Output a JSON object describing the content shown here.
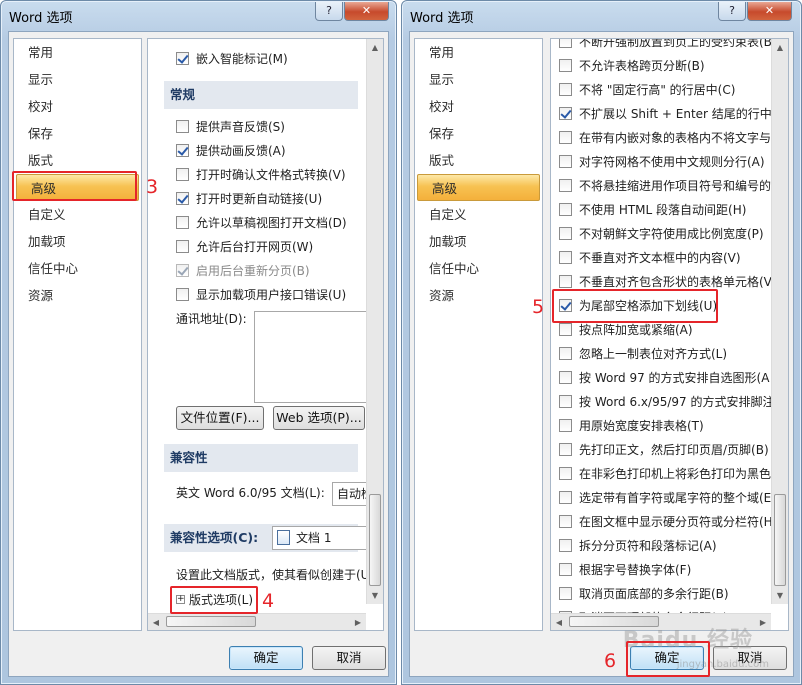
{
  "left": {
    "title": "Word 选项",
    "help": "?",
    "close": "✕",
    "nav": [
      "常用",
      "显示",
      "校对",
      "保存",
      "版式",
      "高级",
      "自定义",
      "加载项",
      "信任中心",
      "资源"
    ],
    "options_top": [
      {
        "label": "嵌入智能标记(M)",
        "checked": true,
        "disabled": false
      }
    ],
    "section_general": "常规",
    "options_general": [
      {
        "label": "提供声音反馈(S)",
        "checked": false,
        "disabled": false
      },
      {
        "label": "提供动画反馈(A)",
        "checked": true,
        "disabled": false
      },
      {
        "label": "打开时确认文件格式转换(V)",
        "checked": false,
        "disabled": false
      },
      {
        "label": "打开时更新自动链接(U)",
        "checked": true,
        "disabled": false
      },
      {
        "label": "允许以草稿视图打开文档(D)",
        "checked": false,
        "disabled": false
      },
      {
        "label": "允许后台打开网页(W)",
        "checked": false,
        "disabled": false
      },
      {
        "label": "启用后台重新分页(B)",
        "checked": true,
        "disabled": true
      },
      {
        "label": "显示加载项用户接口错误(U)",
        "checked": false,
        "disabled": false
      }
    ],
    "mail_label": "通讯地址(D):",
    "file_locations_btn": "文件位置(F)...",
    "web_options_btn": "Web 选项(P)...",
    "section_compat": "兼容性",
    "compat_label": "英文 Word 6.0/95 文档(L):",
    "compat_value": "自动检",
    "section_compat_opts_label": "兼容性选项(C):",
    "compat_doc": "文档 1",
    "layout_desc": "设置此文档版式，使其看似创建于(U)",
    "layout_options": "版式选项(L)",
    "ok": "确定",
    "cancel": "取消",
    "marker3": "3",
    "marker4": "4"
  },
  "right": {
    "title": "Word 选项",
    "help": "?",
    "close": "✕",
    "nav": [
      "常用",
      "显示",
      "校对",
      "保存",
      "版式",
      "高级",
      "自定义",
      "加载项",
      "信任中心",
      "资源"
    ],
    "options": [
      {
        "label": "不断开强制放置到页上的受约束表(B",
        "checked": false
      },
      {
        "label": "不允许表格跨页分断(B)",
        "checked": false
      },
      {
        "label": "不将 \"固定行高\" 的行居中(C)",
        "checked": false
      },
      {
        "label": "不扩展以 Shift + Enter 结尾的行中的",
        "checked": true
      },
      {
        "label": "在带有内嵌对象的表格内不将文字与",
        "checked": false
      },
      {
        "label": "对字符网格不使用中文规则分行(A)",
        "checked": false
      },
      {
        "label": "不将悬挂缩进用作项目符号和编号的",
        "checked": false
      },
      {
        "label": "不使用 HTML 段落自动间距(H)",
        "checked": false
      },
      {
        "label": "不对朝鲜文字符使用成比例宽度(P)",
        "checked": false
      },
      {
        "label": "不垂直对齐文本框中的内容(V)",
        "checked": false
      },
      {
        "label": "不垂直对齐包含形状的表格单元格(V",
        "checked": false
      },
      {
        "label": "为尾部空格添加下划线(U)",
        "checked": true
      },
      {
        "label": "按点阵加宽或紧缩(A)",
        "checked": false
      },
      {
        "label": "忽略上一制表位对齐方式(L)",
        "checked": false
      },
      {
        "label": "按 Word 97 的方式安排自选图形(A",
        "checked": false
      },
      {
        "label": "按 Word 6.x/95/97 的方式安排脚注(",
        "checked": false
      },
      {
        "label": "用原始宽度安排表格(T)",
        "checked": false
      },
      {
        "label": "先打印正文，然后打印页眉/页脚(B)",
        "checked": false
      },
      {
        "label": "在非彩色打印机上将彩色打印为黑色",
        "checked": false
      },
      {
        "label": "选定带有首字符或尾字符的整个域(E",
        "checked": false
      },
      {
        "label": "在图文框中显示硬分页符或分栏符(H",
        "checked": false
      },
      {
        "label": "拆分分页符和段落标记(A)",
        "checked": false
      },
      {
        "label": "根据字号替换字体(F)",
        "checked": false
      },
      {
        "label": "取消页面底部的多余行距(B)",
        "checked": false
      },
      {
        "label": "取消页面顶部的多余行距(T)",
        "checked": false
      }
    ],
    "ok": "确定",
    "cancel": "取消",
    "marker5": "5",
    "marker6": "6",
    "watermark": "Baidu 经验",
    "watermark_url": "jingyan.baidu.com"
  }
}
